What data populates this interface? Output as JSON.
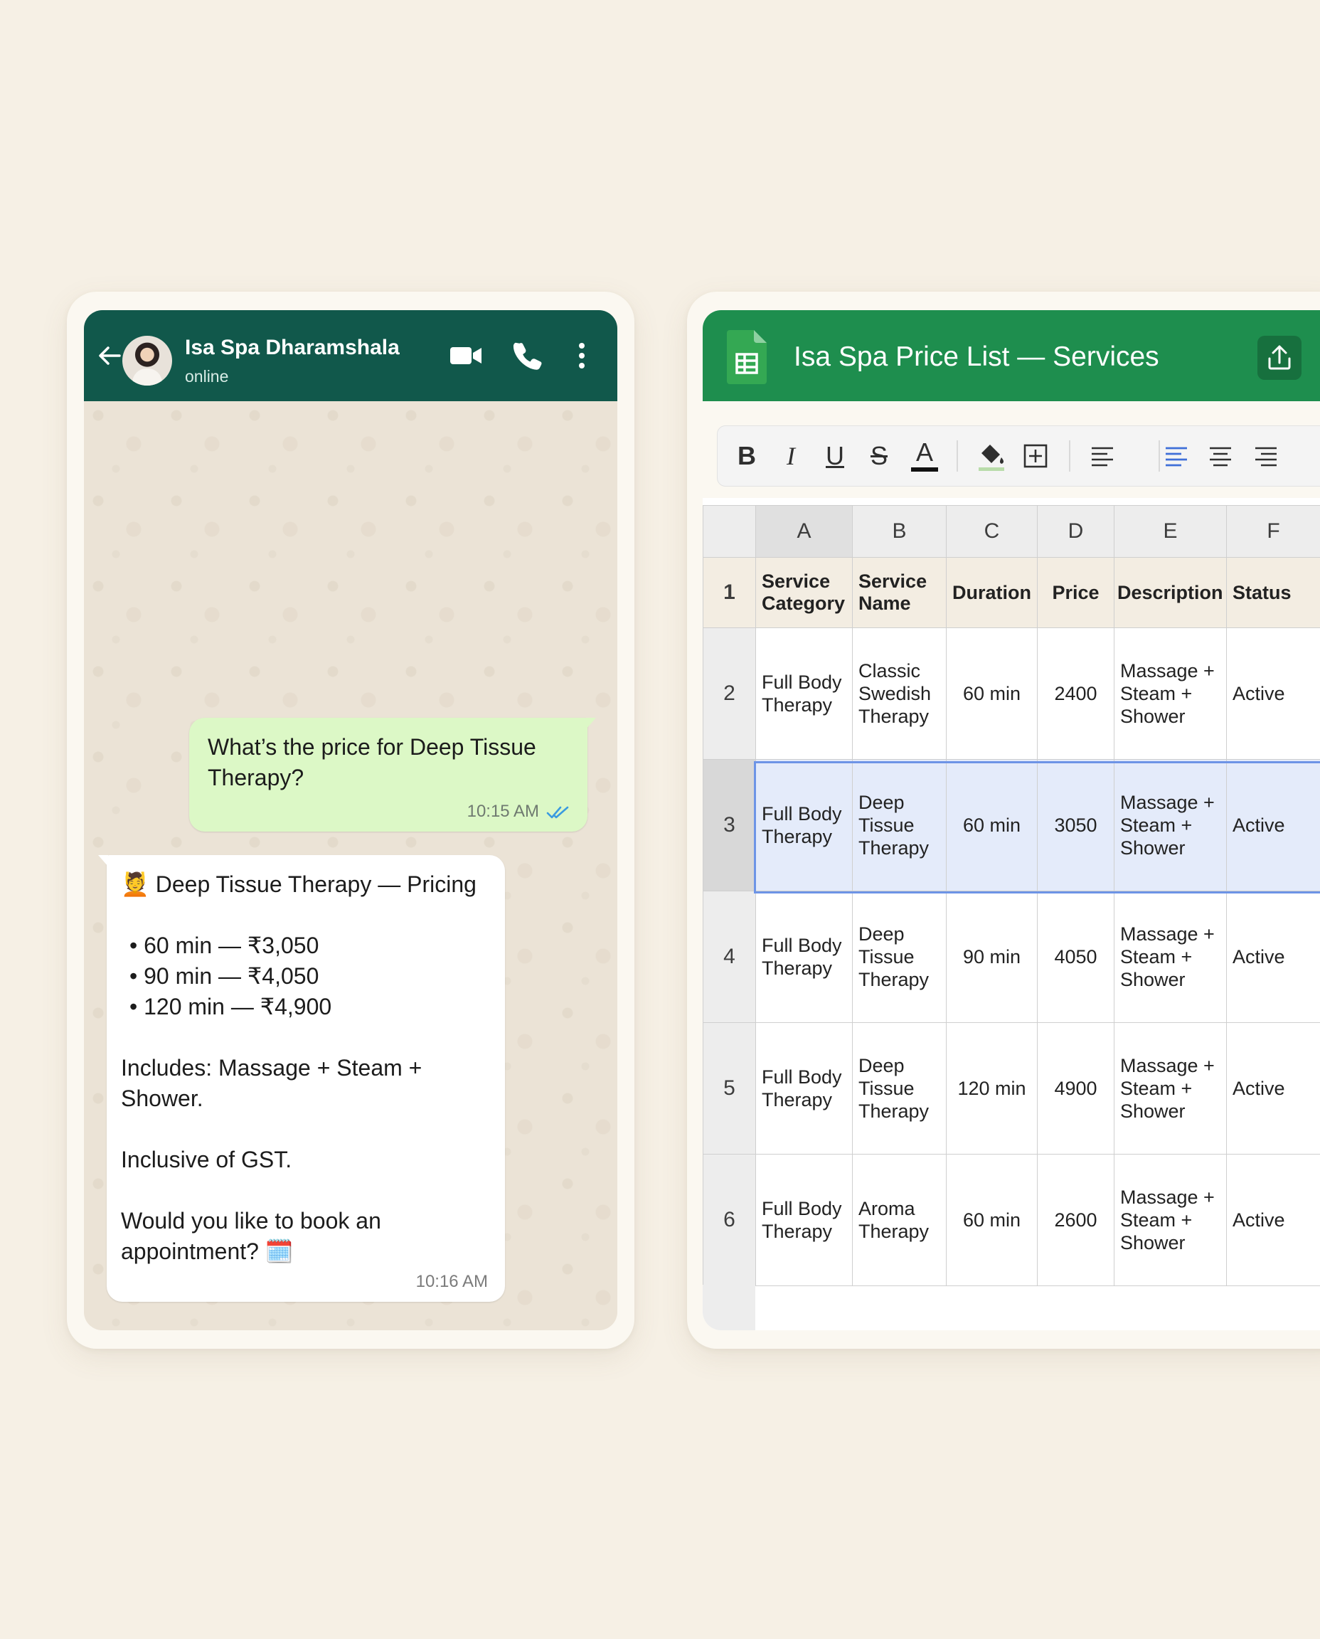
{
  "whatsapp": {
    "contact_name": "Isa Spa Dharamshala",
    "status": "online",
    "outgoing": {
      "text": "What’s the price for Deep Tissue Therapy?",
      "time": "10:15 AM"
    },
    "incoming": {
      "heading": "💆 Deep Tissue Therapy — Pricing",
      "bullets": [
        "• 60 min — ₹3,050",
        "• 90 min — ₹4,050",
        "• 120 min — ₹4,900"
      ],
      "includes": "Includes: Massage + Steam + Shower.",
      "gst": "Inclusive of GST.",
      "question": "Would you like to book an appointment? 🗓️",
      "time": "10:16 AM"
    },
    "icons": [
      "back-arrow-icon",
      "video-call-icon",
      "phone-icon",
      "more-vert-icon",
      "double-check-icon"
    ],
    "colors": {
      "header": "#11584b",
      "outgoing_bubble": "#dcf8c6",
      "incoming_bubble": "#ffffff"
    }
  },
  "sheets": {
    "title": "Isa Spa Price List — Services",
    "toolbar": {
      "bold": "B",
      "italic": "I",
      "underline": "U",
      "strike": "S",
      "text_color": "A"
    },
    "columns": [
      "A",
      "B",
      "C",
      "D",
      "E",
      "F"
    ],
    "row_numbers": [
      "1",
      "2",
      "3",
      "4",
      "5",
      "6"
    ],
    "header_row": [
      "Service Category",
      "Service Name",
      "Duration",
      "Price",
      "Description",
      "Status"
    ],
    "rows": [
      [
        "Full Body Therapy",
        "Classic Swedish Therapy",
        "60 min",
        "2400",
        "Massage + Steam + Shower",
        "Active"
      ],
      [
        "Full Body Therapy",
        "Deep Tissue Therapy",
        "60 min",
        "3050",
        "Massage + Steam + Shower",
        "Active"
      ],
      [
        "Full Body Therapy",
        "Deep Tissue Therapy",
        "90 min",
        "4050",
        "Massage + Steam + Shower",
        "Active"
      ],
      [
        "Full Body Therapy",
        "Deep Tissue Therapy",
        "120 min",
        "4900",
        "Massage + Steam + Shower",
        "Active"
      ],
      [
        "Full Body Therapy",
        "Aroma Therapy",
        "60 min",
        "2600",
        "Massage + Steam + Shower",
        "Active"
      ]
    ],
    "selected_row": "3",
    "colors": {
      "header": "#1e8e4e",
      "selection": "#e4ebfa",
      "selection_border": "#6d94e6"
    }
  }
}
